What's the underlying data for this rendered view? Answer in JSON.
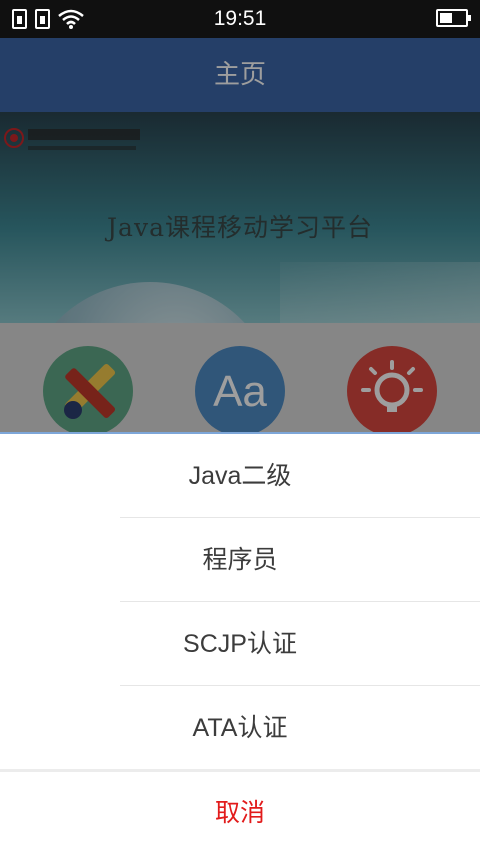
{
  "status_bar": {
    "time": "19:51"
  },
  "header": {
    "title": "主页"
  },
  "banner": {
    "title": "Java课程移动学习平台"
  },
  "categories": [
    {
      "icon": "pencil-tools-icon"
    },
    {
      "icon": "font-aa-icon",
      "glyph": "Aa"
    },
    {
      "icon": "lightbulb-icon"
    }
  ],
  "action_sheet": {
    "items": [
      "Java二级",
      "程序员",
      "SCJP认证",
      "ATA认证"
    ],
    "cancel_label": "取消"
  },
  "colors": {
    "header": "#3d67a8",
    "cancel": "#e21b1b",
    "cat_green": "#5fa786",
    "cat_blue": "#4e8cc4",
    "cat_red": "#d94840"
  }
}
